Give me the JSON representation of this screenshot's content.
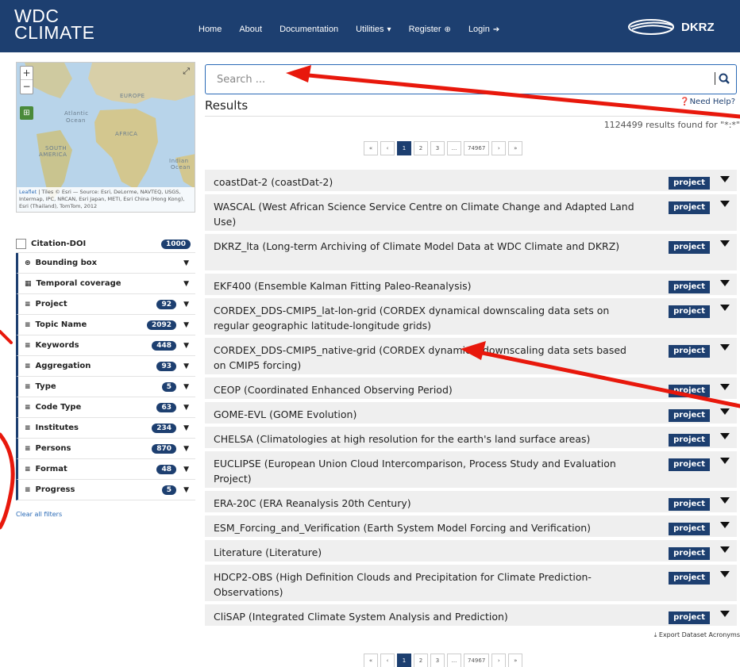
{
  "header": {
    "logo_line1": "WDC",
    "logo_line2": "CLIMATE",
    "nav": [
      {
        "label": "Home"
      },
      {
        "label": "About"
      },
      {
        "label": "Documentation"
      },
      {
        "label": "Utilities",
        "suffix": "▾"
      },
      {
        "label": "Register",
        "suffix": "⊕"
      },
      {
        "label": "Login",
        "suffix": "➔"
      }
    ],
    "dkrz_label": "DKRZ"
  },
  "map": {
    "zoom_in": "+",
    "zoom_out": "−",
    "labels": [
      "EUROPE",
      "Atlantic",
      "Ocean",
      "AFRICA",
      "SOUTH",
      "AMERICA",
      "Indian",
      "Ocean"
    ],
    "attribution_link": "Leaflet",
    "attribution": "| Tiles © Esri — Source: Esri, DeLorme, NAVTEQ, USGS, Intermap, IPC, NRCAN, Esri Japan, METI, Esri China (Hong Kong), Esri (Thailand), TomTom, 2012"
  },
  "facets": [
    {
      "label": "Citation-DOI",
      "count": "1000",
      "icon": "checkbox"
    },
    {
      "label": "Bounding box",
      "count": "",
      "icon": "globe-icon"
    },
    {
      "label": "Temporal coverage",
      "count": "",
      "icon": "calendar-icon"
    },
    {
      "label": "Project",
      "count": "92",
      "icon": "list-icon"
    },
    {
      "label": "Topic Name",
      "count": "2092",
      "icon": "list-icon"
    },
    {
      "label": "Keywords",
      "count": "448",
      "icon": "list-icon"
    },
    {
      "label": "Aggregation",
      "count": "93",
      "icon": "list-icon"
    },
    {
      "label": "Type",
      "count": "5",
      "icon": "list-icon"
    },
    {
      "label": "Code Type",
      "count": "63",
      "icon": "list-icon"
    },
    {
      "label": "Institutes",
      "count": "234",
      "icon": "list-icon"
    },
    {
      "label": "Persons",
      "count": "870",
      "icon": "list-icon"
    },
    {
      "label": "Format",
      "count": "48",
      "icon": "list-icon"
    },
    {
      "label": "Progress",
      "count": "5",
      "icon": "list-icon"
    }
  ],
  "clear_filters": "Clear all filters",
  "search": {
    "placeholder": "Search ..."
  },
  "results": {
    "title": "Results",
    "help": "Need Help?",
    "count_text": "1124499 results found for \"*:*\"",
    "pager": [
      "«",
      "‹",
      "1",
      "2",
      "3",
      "...",
      "74967",
      "›",
      "»"
    ],
    "active_page": "1",
    "badge": "project",
    "items": [
      "coastDat-2 (coastDat-2)",
      "WASCAL (West African Science Service Centre on Climate Change and Adapted Land Use)",
      "DKRZ_lta (Long-term Archiving of Climate Model Data at WDC Climate and DKRZ)",
      "EKF400 (Ensemble Kalman Fitting Paleo-Reanalysis)",
      "CORDEX_DDS-CMIP5_lat-lon-grid (CORDEX dynamical downscaling data sets on regular geographic latitude-longitude grids)",
      "CORDEX_DDS-CMIP5_native-grid (CORDEX dynamical downscaling data sets based on CMIP5 forcing)",
      "CEOP (Coordinated Enhanced Observing Period)",
      "GOME-EVL (GOME Evolution)",
      "CHELSA (Climatologies at high resolution for the earth's land surface areas)",
      "EUCLIPSE (European Union Cloud Intercomparison, Process Study and Evaluation Project)",
      "ERA-20C (ERA Reanalysis 20th Century)",
      "ESM_Forcing_and_Verification (Earth System Model Forcing and Verification)",
      "Literature (Literature)",
      "HDCP2-OBS (High Definition Clouds and Precipitation for Climate Prediction-Observations)",
      "CliSAP (Integrated Climate System Analysis and Prediction)"
    ],
    "export": "Export Dataset Acronyms"
  },
  "colors": {
    "navy": "#1d3f70",
    "annotation_red": "#e8180c"
  }
}
